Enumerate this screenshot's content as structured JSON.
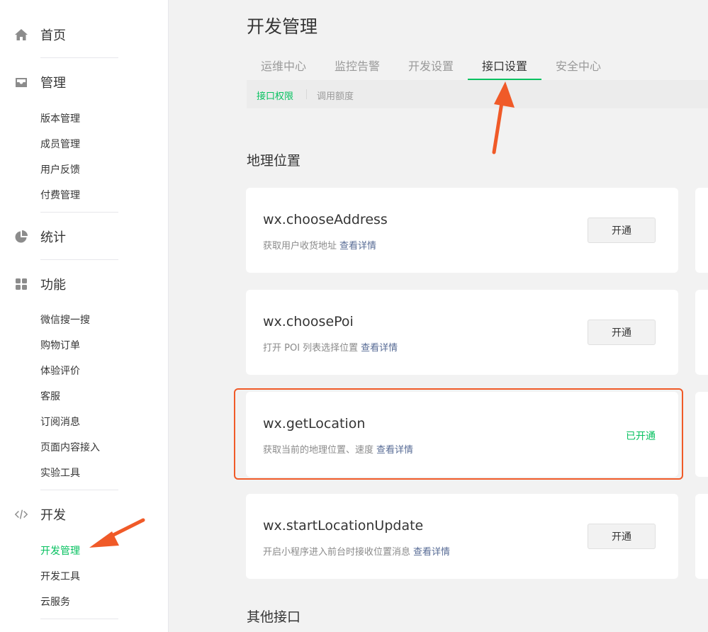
{
  "sidebar": {
    "home": {
      "label": "首页",
      "icon": "home-icon"
    },
    "manage": {
      "label": "管理",
      "icon": "inbox-icon",
      "items": [
        "版本管理",
        "成员管理",
        "用户反馈",
        "付费管理"
      ]
    },
    "stats": {
      "label": "统计",
      "icon": "pie-chart-icon"
    },
    "features": {
      "label": "功能",
      "icon": "grid-icon",
      "items": [
        "微信搜一搜",
        "购物订单",
        "体验评价",
        "客服",
        "订阅消息",
        "页面内容接入",
        "实验工具"
      ]
    },
    "dev": {
      "label": "开发",
      "icon": "code-icon",
      "items": [
        "开发管理",
        "开发工具",
        "云服务"
      ],
      "active_item": "开发管理"
    }
  },
  "page": {
    "title": "开发管理"
  },
  "tabs": [
    "运维中心",
    "监控告警",
    "开发设置",
    "接口设置",
    "安全中心"
  ],
  "active_tab": "接口设置",
  "subtabs": [
    "接口权限",
    "调用额度"
  ],
  "active_subtab": "接口权限",
  "sections": {
    "location": {
      "title": "地理位置"
    },
    "other": {
      "title": "其他接口"
    }
  },
  "cards": [
    {
      "name": "wx.chooseAddress",
      "desc": "获取用户收货地址",
      "link": "查看详情",
      "action": "开通"
    },
    {
      "name": "wx.choosePoi",
      "desc": "打开 POI 列表选择位置",
      "link": "查看详情",
      "action": "开通"
    },
    {
      "name": "wx.getLocation",
      "desc": "获取当前的地理位置、速度",
      "link": "查看详情",
      "status": "已开通"
    },
    {
      "name": "wx.startLocationUpdate",
      "desc": "开启小程序进入前台时接收位置消息",
      "link": "查看详情",
      "action": "开通"
    }
  ],
  "colors": {
    "accent": "#07c160",
    "link": "#576b95",
    "annotation": "#f05a28"
  }
}
